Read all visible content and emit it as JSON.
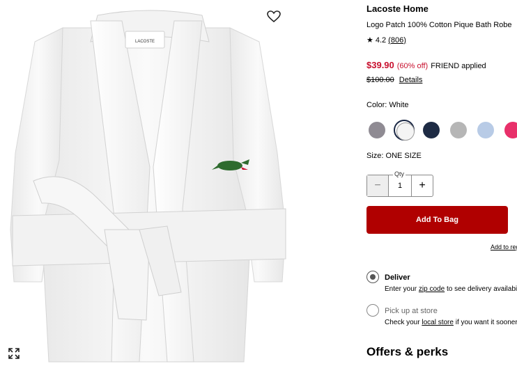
{
  "product": {
    "brand": "Lacoste Home",
    "name": "Logo Patch 100% Cotton Pique Bath Robe",
    "rating": "4.2",
    "review_count": "(806)",
    "image_tag": "LACOSTE"
  },
  "price": {
    "sale": "$39.90",
    "discount": "(60% off)",
    "promo": "FRIEND applied",
    "original": "$100.00",
    "details_link": "Details"
  },
  "color": {
    "label": "Color: White",
    "swatches": [
      {
        "name": "gray",
        "hex": "#8f8b93"
      },
      {
        "name": "white",
        "hex": "#f4f4f4",
        "selected": true
      },
      {
        "name": "navy",
        "hex": "#1e2b44"
      },
      {
        "name": "heather",
        "hex": "#b6b6b6"
      },
      {
        "name": "light-blue",
        "hex": "#b8cbe6"
      },
      {
        "name": "pink",
        "hex": "#e8306a"
      }
    ]
  },
  "size": {
    "label": "Size: ONE SIZE"
  },
  "quantity": {
    "label": "Qty",
    "value": "1",
    "minus": "−",
    "plus": "+"
  },
  "actions": {
    "add_to_bag": "Add To Bag",
    "add_to_list": "Add to registry"
  },
  "fulfillment": {
    "deliver_title": "Deliver",
    "deliver_prefix": "Enter your",
    "deliver_link": "zip code",
    "deliver_suffix": "to see delivery availability",
    "pickup_title": "Pick up at store",
    "pickup_prefix": "Check your",
    "pickup_link": "local store",
    "pickup_suffix": "if you want it sooner"
  },
  "offers": {
    "title": "Offers & perks"
  },
  "icons": {
    "wishlist": "heart-icon",
    "zoom": "expand-icon",
    "star": "star-icon"
  },
  "colors": {
    "sale_red": "#c8102e",
    "button_red": "#b00000"
  }
}
